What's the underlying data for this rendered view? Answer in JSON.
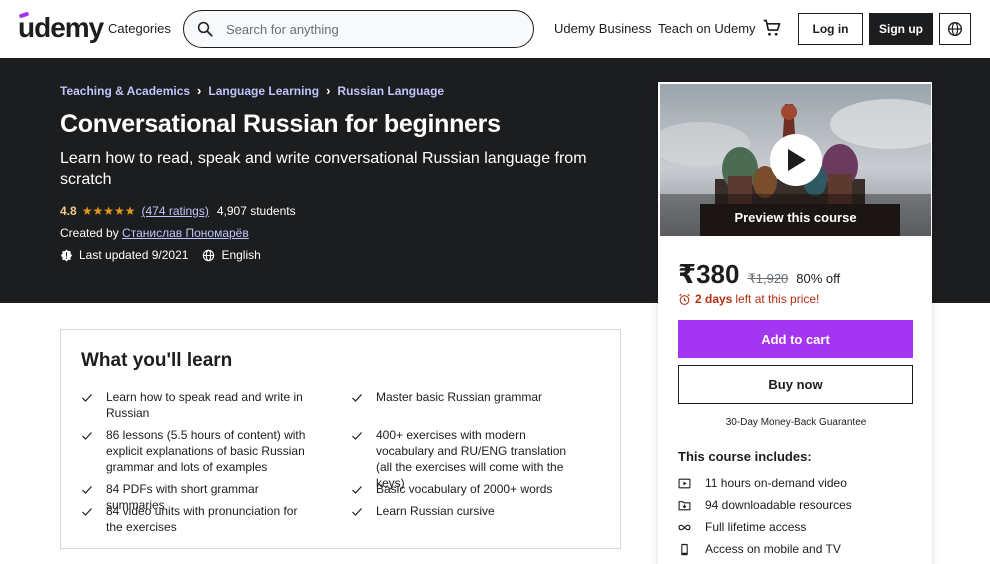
{
  "header": {
    "logo": "udemy",
    "categories": "Categories",
    "search_placeholder": "Search for anything",
    "udemy_business": "Udemy Business",
    "teach": "Teach on Udemy",
    "login": "Log in",
    "signup": "Sign up"
  },
  "breadcrumb": [
    "Teaching & Academics",
    "Language Learning",
    "Russian Language"
  ],
  "course": {
    "title": "Conversational Russian for beginners",
    "subtitle": "Learn how to read, speak and write conversational Russian language from scratch",
    "rating": "4.8",
    "stars": "★★★★★",
    "ratings_count": "(474 ratings)",
    "students": "4,907 students",
    "created_by_label": "Created by",
    "author": "Станислав Пономарёв",
    "last_updated": "Last updated 9/2021",
    "language": "English"
  },
  "sidebar": {
    "preview_label": "Preview this course",
    "price": "₹380",
    "old_price": "₹1,920",
    "discount": "80% off",
    "timer_days": "2 days",
    "timer_rest": "left at this price!",
    "add_to_cart": "Add to cart",
    "buy_now": "Buy now",
    "guarantee": "30-Day Money-Back Guarantee",
    "includes_title": "This course includes:",
    "includes": [
      "11 hours on-demand video",
      "94 downloadable resources",
      "Full lifetime access",
      "Access on mobile and TV"
    ]
  },
  "learn": {
    "title": "What you'll learn",
    "items": [
      "Learn how to speak read and write in Russian",
      "Master basic Russian grammar",
      "86 lessons (5.5 hours of content) with explicit explanations of basic Russian grammar and lots of examples",
      "400+ exercises with modern vocabulary and RU/ENG translation (all the exercises will come with the keys)",
      "84 PDFs with short grammar summaries",
      "Basic vocabulary of 2000+ words",
      "84 video units with pronunciation for the exercises",
      "Learn Russian cursive"
    ]
  },
  "colors": {
    "brand": "#a435f0",
    "hero_bg": "#1c1d1f",
    "link_light": "#c0c4fc",
    "star": "#e59819",
    "timer": "#b32d0f"
  }
}
